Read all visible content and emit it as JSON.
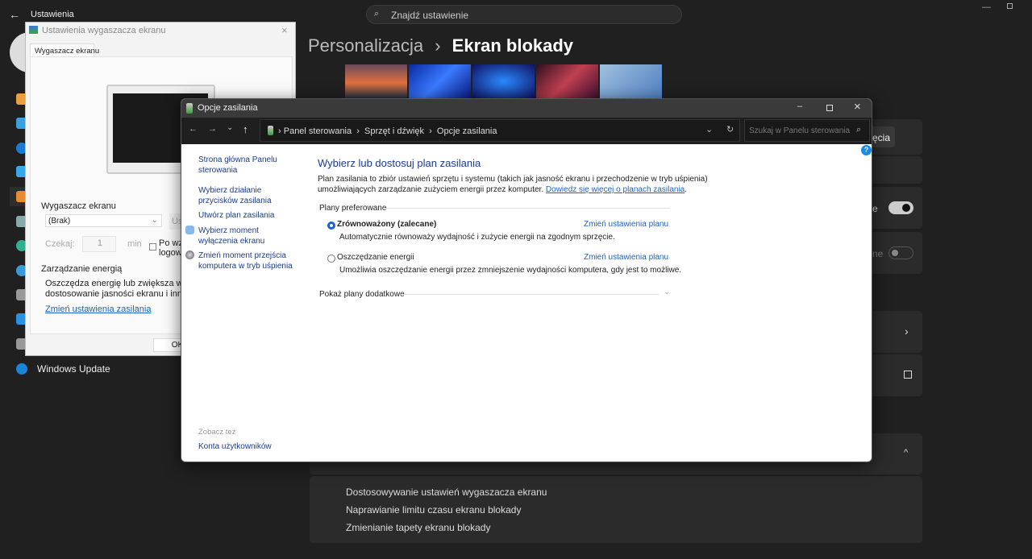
{
  "settings": {
    "title": "Ustawienia",
    "search_placeholder": "Znajdź ustawienie",
    "breadcrumb_parent": "Personalizacja",
    "breadcrumb_sep": "›",
    "breadcrumb_current": "Ekran blokady",
    "sidebar_windows_update": "Windows Update",
    "partial_button": "ęcia",
    "toggle_on_label": "e",
    "toggle_off_label": "ne",
    "toggle_1_on": true,
    "toggle_2_on": false,
    "related_links": [
      "Dostosowywanie ustawień wygaszacza ekranu",
      "Naprawianie limitu czasu ekranu blokady",
      "Zmienianie tapety ekranu blokady"
    ]
  },
  "screensaver_dialog": {
    "title": "Ustawienia wygaszacza ekranu",
    "tab": "Wygaszacz ekranu",
    "group_label": "Wygaszacz ekranu",
    "select_value": "(Brak)",
    "settings_button": "Us",
    "wait_label": "Czekaj:",
    "wait_value": "1",
    "wait_unit": "min",
    "resume_checkbox_line1": "Po wzn",
    "resume_checkbox_line2": "logowa",
    "power_group_label": "Zarządzanie energią",
    "power_text_line1": "Oszczędza energię lub zwiększa wydajnoś",
    "power_text_line2": "dostosowanie jasności ekranu i innych ust",
    "power_link": "Zmień ustawienia zasilania",
    "ok_button": "OK"
  },
  "power_window": {
    "title": "Opcje zasilania",
    "breadcrumb": [
      "Panel sterowania",
      "Sprzęt i dźwięk",
      "Opcje zasilania"
    ],
    "search_placeholder": "Szukaj w Panelu sterowania",
    "left_links": [
      "Strona główna Panelu sterowania",
      "Wybierz działanie przycisków zasilania",
      "Utwórz plan zasilania",
      "Wybierz moment wyłączenia ekranu",
      "Zmień moment przejścia komputera w tryb uśpienia"
    ],
    "see_also_label": "Zobacz też",
    "see_also_link": "Konta użytkowników",
    "heading": "Wybierz lub dostosuj plan zasilania",
    "intro": "Plan zasilania to zbiór ustawień sprzętu i systemu (takich jak jasność ekranu i przechodzenie w tryb uśpienia)",
    "intro2": "umożliwiających zarządzanie zużyciem energii przez komputer.",
    "learn_more": "Dowiedz się więcej o planach zasilania",
    "preferred_label": "Plany preferowane",
    "plans": [
      {
        "name": "Zrównoważony (zalecane)",
        "selected": true,
        "desc": "Automatycznie równoważy wydajność i zużycie energii na zgodnym sprzęcie.",
        "link": "Zmień ustawienia planu"
      },
      {
        "name": "Oszczędzanie energii",
        "selected": false,
        "desc": "Umożliwia oszczędzanie energii przez zmniejszenie wydajności komputera, gdy jest to możliwe.",
        "link": "Zmień ustawienia planu"
      }
    ],
    "show_more": "Pokaż plany dodatkowe",
    "help": "?"
  }
}
